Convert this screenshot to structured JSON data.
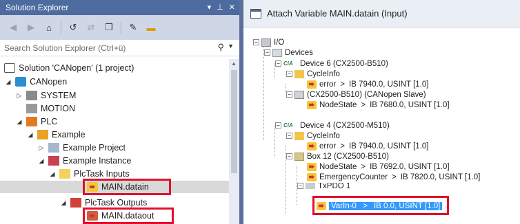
{
  "solution_explorer": {
    "title": "Solution Explorer",
    "title_controls": [
      "▾",
      "ᵖ",
      "✕"
    ],
    "search_placeholder": "Search Solution Explorer (Ctrl+ü)",
    "tree": {
      "solution": "Solution 'CANopen' (1 project)",
      "project": "CANopen",
      "system": "SYSTEM",
      "motion": "MOTION",
      "plc": "PLC",
      "example": "Example",
      "example_project": "Example Project",
      "example_instance": "Example Instance",
      "plctask_inputs": "PlcTask Inputs",
      "main_datain": "MAIN.datain",
      "plctask_outputs": "PlcTask Outputs",
      "main_dataout": "MAIN.dataout"
    }
  },
  "dialog": {
    "title": "Attach Variable MAIN.datain (Input)",
    "tree": {
      "io": "I/O",
      "devices": "Devices",
      "device6": "Device 6 (CX2500-B510)",
      "cycleinfo_1": "CycleInfo",
      "error_1": {
        "name": "error",
        "sep": ">",
        "addr": "IB 7940.0, USINT [1.0]"
      },
      "slave": "(CX2500-B510) (CANopen Slave)",
      "nodestate_1": {
        "name": "NodeState",
        "sep": ">",
        "addr": "IB 7680.0, USINT [1.0]"
      },
      "device4": "Device 4 (CX2500-M510)",
      "cycleinfo_2": "CycleInfo",
      "error_2": {
        "name": "error",
        "sep": ">",
        "addr": "IB 7940.0, USINT [1.0]"
      },
      "box12": "Box 12 (CX2500-B510)",
      "nodestate_2": {
        "name": "NodeState",
        "sep": ">",
        "addr": "IB 7692.0, USINT [1.0]"
      },
      "emergency": {
        "name": "EmergencyCounter",
        "sep": ">",
        "addr": "IB 7820.0, USINT [1.0]"
      },
      "txpdo": "TxPDO 1",
      "varin0": {
        "name": "VarIn-0",
        "sep": ">",
        "addr": "IB 0.0, USINT [1.0]"
      }
    }
  },
  "colors": {
    "titlebar": "#4e6b9f",
    "highlight_box": "#e0102a",
    "selection": "#3399ff"
  }
}
